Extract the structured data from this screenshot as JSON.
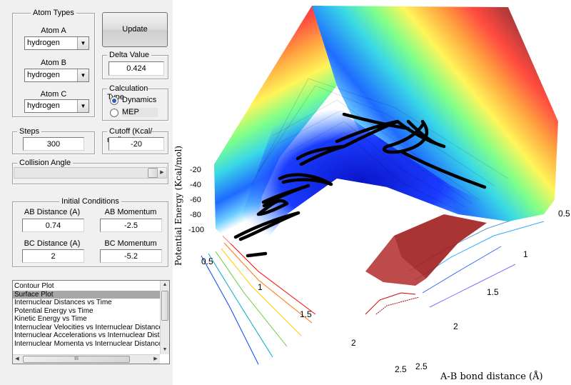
{
  "atom_types": {
    "title": "Atom Types",
    "atom_a": {
      "label": "Atom A",
      "value": "hydrogen"
    },
    "atom_b": {
      "label": "Atom B",
      "value": "hydrogen"
    },
    "atom_c": {
      "label": "Atom C",
      "value": "hydrogen"
    }
  },
  "update_button": "Update",
  "delta": {
    "title": "Delta Value",
    "value": "0.424"
  },
  "calc_type": {
    "title": "Calculation Type",
    "options": [
      "Dynamics",
      "MEP"
    ],
    "selected": "Dynamics"
  },
  "steps": {
    "title": "Steps",
    "value": "300"
  },
  "cutoff": {
    "title": "Cutoff (Kcal/ mol)",
    "value": "-20"
  },
  "collision": {
    "title": "Collision Angle",
    "slider_fraction": 0.98
  },
  "initial_conditions": {
    "title": "Initial Conditions",
    "ab_distance": {
      "label": "AB Distance (A)",
      "value": "0.74"
    },
    "ab_momentum": {
      "label": "AB Momentum",
      "value": "-2.5"
    },
    "bc_distance": {
      "label": "BC Distance (A)",
      "value": "2"
    },
    "bc_momentum": {
      "label": "BC Momentum",
      "value": "-5.2"
    }
  },
  "plot_list": {
    "items": [
      "Contour Plot",
      "Surface Plot",
      "Internuclear Distances vs Time",
      "Potential Energy vs Time",
      "Kinetic Energy vs Time",
      "Internuclear Velocities vs Internuclear Distances",
      "Internuclear Accelerations vs Internuclear Distances",
      "Internuclear Momenta vs Internuclear Distances"
    ],
    "selected": "Surface Plot",
    "hscroll_grip": "III"
  },
  "chart_data": {
    "type": "surface",
    "zlabel": "Potential Energy  (Kcal/mol)",
    "xlabel": "A-B bond distance (Å)",
    "zticks": [
      "-20",
      "-40",
      "-60",
      "-80",
      "-100"
    ],
    "xticks": [
      "0.5",
      "1",
      "1.5",
      "2",
      "2.5"
    ],
    "yticks": [
      "0.5",
      "1",
      "1.5",
      "2",
      "2.5"
    ],
    "colormap": "jet"
  }
}
